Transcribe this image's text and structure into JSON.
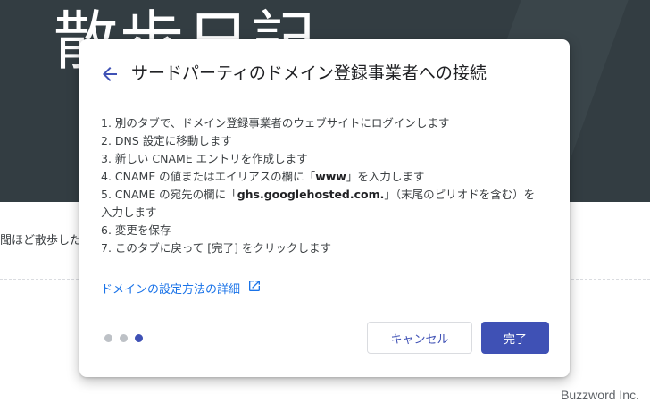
{
  "background": {
    "hero_title": "散歩日記",
    "body_text": "聞ほど散歩した",
    "watermark": "Buzzword Inc."
  },
  "dialog": {
    "title": "サードパーティのドメイン登録事業者への接続",
    "steps": {
      "s1": "1. 別のタブで、ドメイン登録事業者のウェブサイトにログインします",
      "s2": "2. DNS 設定に移動します",
      "s3": "3. 新しい CNAME エントリを作成します",
      "s4_pre": "4. CNAME の値またはエイリアスの欄に「",
      "s4_bold": "www",
      "s4_post": "」を入力します",
      "s5_pre": "5. CNAME の宛先の欄に「",
      "s5_bold": "ghs.googlehosted.com.",
      "s5_post": "」（末尾のピリオドを含む）を入力します",
      "s6": "6. 変更を保存",
      "s7": "7. このタブに戻って [完了] をクリックします"
    },
    "help_link": "ドメインの設定方法の詳細",
    "pagination": {
      "total": 3,
      "current": 3
    },
    "cancel_label": "キャンセル",
    "done_label": "完了",
    "icons": {
      "back": "arrow-back-icon",
      "external": "open-in-new-icon"
    },
    "colors": {
      "primary": "#3f51b5",
      "link": "#1a73e8",
      "hero_bg": "#333d42"
    }
  }
}
